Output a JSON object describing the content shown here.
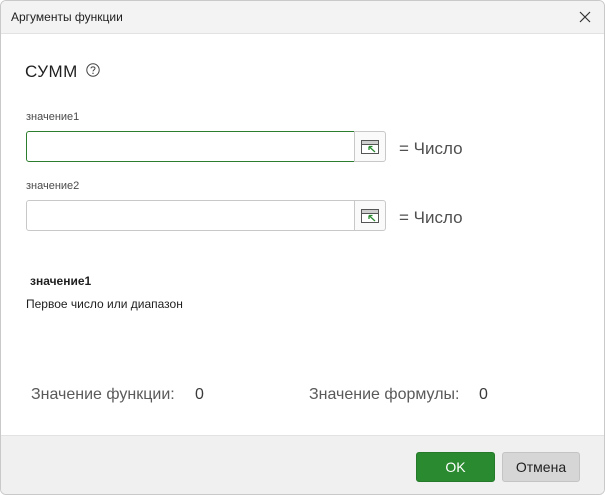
{
  "window": {
    "title": "Аргументы функции",
    "close_icon": "close-icon"
  },
  "function": {
    "name": "СУММ",
    "help_icon": "question-circle-icon"
  },
  "arguments": [
    {
      "label": "значение1",
      "value": "",
      "result": "= Число",
      "focused": true,
      "picker_icon": "range-select-icon"
    },
    {
      "label": "значение2",
      "value": "",
      "result": "= Число",
      "focused": false,
      "picker_icon": "range-select-icon"
    }
  ],
  "description": {
    "arg_name": "значение1",
    "text": "Первое число или диапазон"
  },
  "results": {
    "function_value_label": "Значение функции:",
    "function_value": "0",
    "formula_value_label": "Значение формулы:",
    "formula_value": "0"
  },
  "buttons": {
    "ok_label": "OK",
    "cancel_label": "Отмена"
  },
  "colors": {
    "accent": "#2a8a30",
    "focus_border": "#2d7d2f",
    "footer_bg": "#f0f0f0"
  }
}
